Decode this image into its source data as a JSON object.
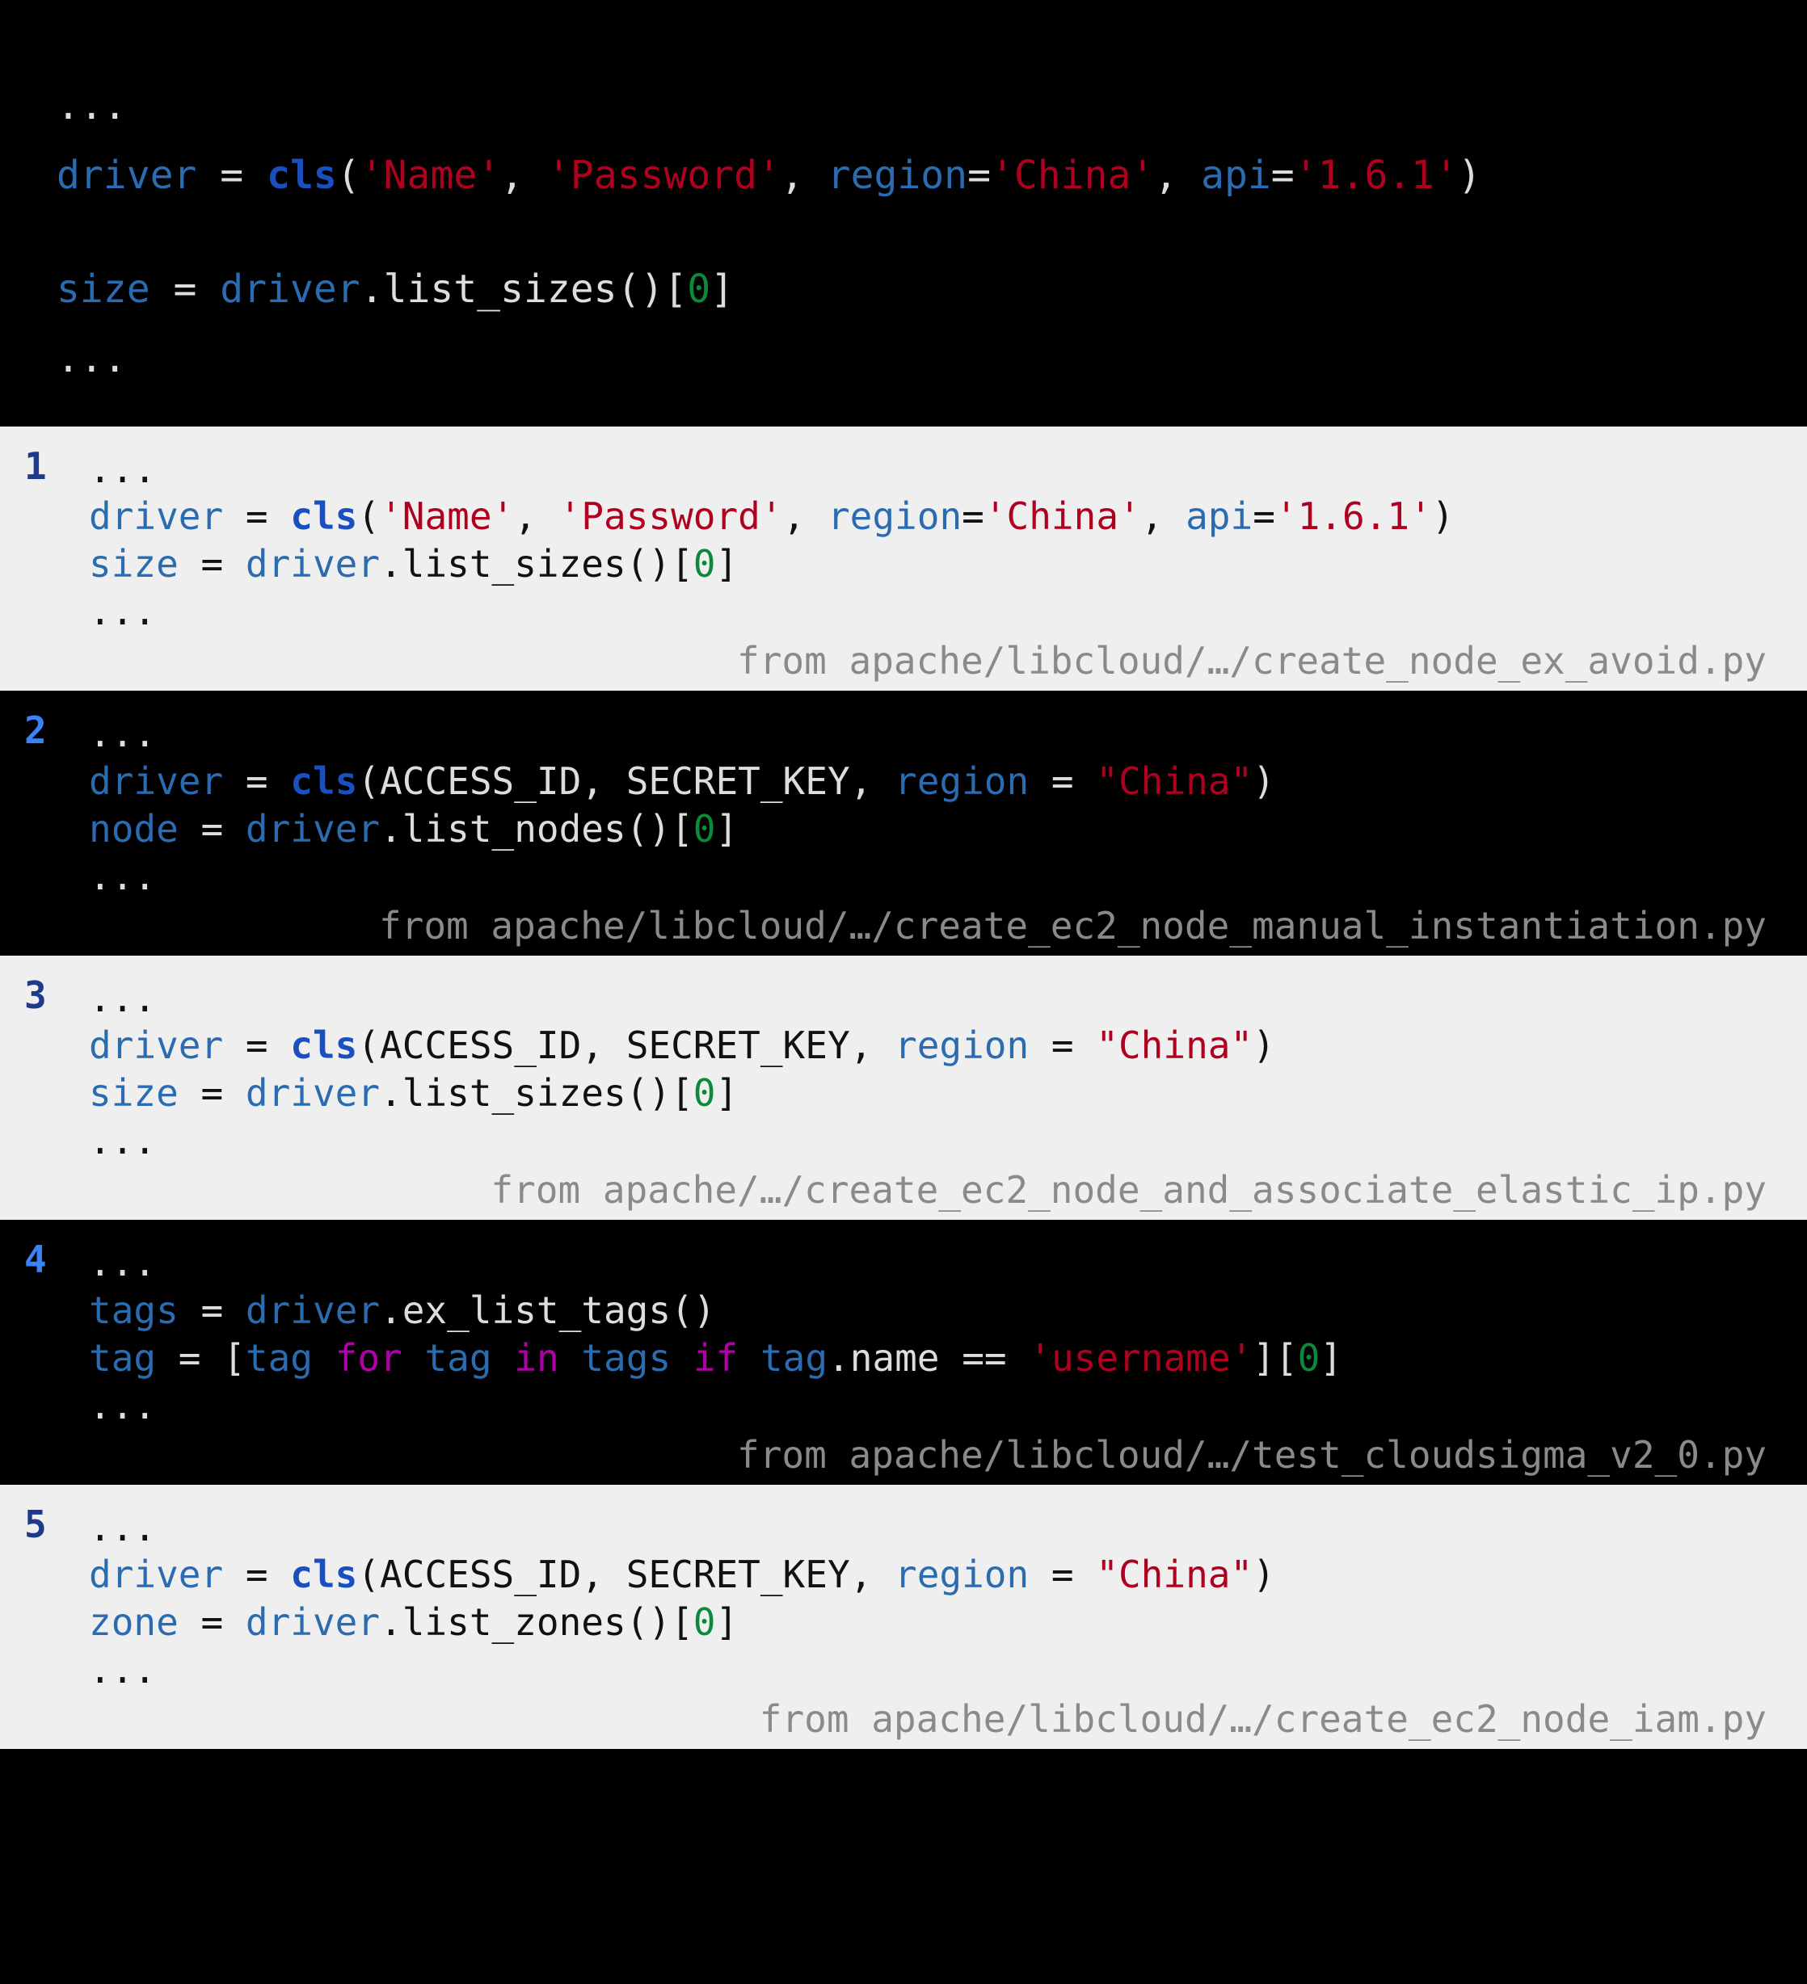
{
  "query": {
    "tokens_line1": [
      {
        "t": "...",
        "c": "def"
      },
      {
        "t": "",
        "c": "nl"
      },
      {
        "t": "driver",
        "c": "id"
      },
      {
        "t": " = ",
        "c": "def"
      },
      {
        "t": "cls",
        "c": "fn"
      },
      {
        "t": "(",
        "c": "def"
      },
      {
        "t": "'Name'",
        "c": "str"
      },
      {
        "t": ", ",
        "c": "def"
      },
      {
        "t": "'Password'",
        "c": "str"
      },
      {
        "t": ", ",
        "c": "def"
      },
      {
        "t": "region",
        "c": "id"
      },
      {
        "t": "=",
        "c": "def"
      },
      {
        "t": "'China'",
        "c": "str"
      },
      {
        "t": ", ",
        "c": "def"
      },
      {
        "t": "api",
        "c": "id"
      },
      {
        "t": "=",
        "c": "def"
      },
      {
        "t": "'1.6.1'",
        "c": "str"
      },
      {
        "t": ")",
        "c": "def"
      }
    ],
    "tokens_line2": [
      {
        "t": "size",
        "c": "id"
      },
      {
        "t": " = ",
        "c": "def"
      },
      {
        "t": "driver",
        "c": "id"
      },
      {
        "t": ".list_sizes()[",
        "c": "def"
      },
      {
        "t": "0",
        "c": "num"
      },
      {
        "t": "]",
        "c": "def"
      }
    ],
    "tokens_line3": [
      {
        "t": "...",
        "c": "def"
      }
    ]
  },
  "results": [
    {
      "index": "1",
      "theme": "light",
      "source": "from apache/libcloud/…/create_node_ex_avoid.py",
      "lines": [
        [
          {
            "t": "...",
            "c": "defL"
          }
        ],
        [
          {
            "t": "driver",
            "c": "id"
          },
          {
            "t": " = ",
            "c": "defL"
          },
          {
            "t": "cls",
            "c": "fn"
          },
          {
            "t": "(",
            "c": "defL"
          },
          {
            "t": "'Name'",
            "c": "str"
          },
          {
            "t": ", ",
            "c": "defL"
          },
          {
            "t": "'Password'",
            "c": "str"
          },
          {
            "t": ", ",
            "c": "defL"
          },
          {
            "t": "region",
            "c": "id"
          },
          {
            "t": "=",
            "c": "defL"
          },
          {
            "t": "'China'",
            "c": "str"
          },
          {
            "t": ", ",
            "c": "defL"
          },
          {
            "t": "api",
            "c": "id"
          },
          {
            "t": "=",
            "c": "defL"
          },
          {
            "t": "'1.6.1'",
            "c": "str"
          },
          {
            "t": ")",
            "c": "defL"
          }
        ],
        [
          {
            "t": "size",
            "c": "id"
          },
          {
            "t": " = ",
            "c": "defL"
          },
          {
            "t": "driver",
            "c": "id"
          },
          {
            "t": ".list_sizes()[",
            "c": "defL"
          },
          {
            "t": "0",
            "c": "num"
          },
          {
            "t": "]",
            "c": "defL"
          }
        ],
        [
          {
            "t": "...",
            "c": "defL"
          }
        ]
      ]
    },
    {
      "index": "2",
      "theme": "dark",
      "source": "from apache/libcloud/…/create_ec2_node_manual_instantiation.py",
      "lines": [
        [
          {
            "t": "...",
            "c": "def"
          }
        ],
        [
          {
            "t": "driver",
            "c": "id"
          },
          {
            "t": " = ",
            "c": "def"
          },
          {
            "t": "cls",
            "c": "fn"
          },
          {
            "t": "(ACCESS_ID, SECRET_KEY, ",
            "c": "def"
          },
          {
            "t": "region",
            "c": "id"
          },
          {
            "t": " = ",
            "c": "def"
          },
          {
            "t": "\"China\"",
            "c": "str"
          },
          {
            "t": ")",
            "c": "def"
          }
        ],
        [
          {
            "t": "node",
            "c": "id"
          },
          {
            "t": " = ",
            "c": "def"
          },
          {
            "t": "driver",
            "c": "id"
          },
          {
            "t": ".list_nodes()[",
            "c": "def"
          },
          {
            "t": "0",
            "c": "num"
          },
          {
            "t": "]",
            "c": "def"
          }
        ],
        [
          {
            "t": "...",
            "c": "def"
          }
        ]
      ]
    },
    {
      "index": "3",
      "theme": "light",
      "source": "from apache/…/create_ec2_node_and_associate_elastic_ip.py",
      "lines": [
        [
          {
            "t": "...",
            "c": "defL"
          }
        ],
        [
          {
            "t": "driver",
            "c": "id"
          },
          {
            "t": " = ",
            "c": "defL"
          },
          {
            "t": "cls",
            "c": "fn"
          },
          {
            "t": "(ACCESS_ID, SECRET_KEY, ",
            "c": "defL"
          },
          {
            "t": "region",
            "c": "id"
          },
          {
            "t": " = ",
            "c": "defL"
          },
          {
            "t": "\"China\"",
            "c": "str"
          },
          {
            "t": ")",
            "c": "defL"
          }
        ],
        [
          {
            "t": "size",
            "c": "id"
          },
          {
            "t": " = ",
            "c": "defL"
          },
          {
            "t": "driver",
            "c": "id"
          },
          {
            "t": ".list_sizes()[",
            "c": "defL"
          },
          {
            "t": "0",
            "c": "num"
          },
          {
            "t": "]",
            "c": "defL"
          }
        ],
        [
          {
            "t": "...",
            "c": "defL"
          }
        ]
      ]
    },
    {
      "index": "4",
      "theme": "dark",
      "source": "from apache/libcloud/…/test_cloudsigma_v2_0.py",
      "lines": [
        [
          {
            "t": "...",
            "c": "def"
          }
        ],
        [
          {
            "t": "tags",
            "c": "id"
          },
          {
            "t": " = ",
            "c": "def"
          },
          {
            "t": "driver",
            "c": "id"
          },
          {
            "t": ".ex_list_tags()",
            "c": "def"
          }
        ],
        [
          {
            "t": "tag",
            "c": "id"
          },
          {
            "t": " = [",
            "c": "def"
          },
          {
            "t": "tag",
            "c": "id"
          },
          {
            "t": " ",
            "c": "def"
          },
          {
            "t": "for",
            "c": "kw"
          },
          {
            "t": " ",
            "c": "def"
          },
          {
            "t": "tag",
            "c": "id"
          },
          {
            "t": " ",
            "c": "def"
          },
          {
            "t": "in",
            "c": "kw"
          },
          {
            "t": " ",
            "c": "def"
          },
          {
            "t": "tags",
            "c": "id"
          },
          {
            "t": " ",
            "c": "def"
          },
          {
            "t": "if",
            "c": "kw"
          },
          {
            "t": " ",
            "c": "def"
          },
          {
            "t": "tag",
            "c": "id"
          },
          {
            "t": ".name == ",
            "c": "def"
          },
          {
            "t": "'username'",
            "c": "str"
          },
          {
            "t": "][",
            "c": "def"
          },
          {
            "t": "0",
            "c": "num"
          },
          {
            "t": "]",
            "c": "def"
          }
        ],
        [
          {
            "t": "...",
            "c": "def"
          }
        ]
      ]
    },
    {
      "index": "5",
      "theme": "light",
      "source": "from apache/libcloud/…/create_ec2_node_iam.py",
      "lines": [
        [
          {
            "t": "...",
            "c": "defL"
          }
        ],
        [
          {
            "t": "driver",
            "c": "id"
          },
          {
            "t": " = ",
            "c": "defL"
          },
          {
            "t": "cls",
            "c": "fn"
          },
          {
            "t": "(ACCESS_ID, SECRET_KEY, ",
            "c": "defL"
          },
          {
            "t": "region",
            "c": "id"
          },
          {
            "t": " = ",
            "c": "defL"
          },
          {
            "t": "\"China\"",
            "c": "str"
          },
          {
            "t": ")",
            "c": "defL"
          }
        ],
        [
          {
            "t": "zone",
            "c": "id"
          },
          {
            "t": " = ",
            "c": "defL"
          },
          {
            "t": "driver",
            "c": "id"
          },
          {
            "t": ".list_zones()[",
            "c": "defL"
          },
          {
            "t": "0",
            "c": "num"
          },
          {
            "t": "]",
            "c": "defL"
          }
        ],
        [
          {
            "t": "...",
            "c": "defL"
          }
        ]
      ]
    }
  ]
}
